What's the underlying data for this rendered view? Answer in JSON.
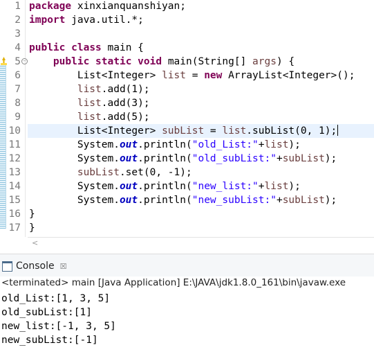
{
  "editor": {
    "lines": [
      {
        "n": "1",
        "tokens": [
          {
            "t": "package",
            "c": "kw"
          },
          {
            "t": " xinxianquanshiyan;",
            "c": ""
          }
        ]
      },
      {
        "n": "2",
        "tokens": [
          {
            "t": "import",
            "c": "kw"
          },
          {
            "t": " java.util.*;",
            "c": ""
          }
        ]
      },
      {
        "n": "3",
        "tokens": []
      },
      {
        "n": "4",
        "tokens": [
          {
            "t": "public",
            "c": "kw"
          },
          {
            "t": " ",
            "c": ""
          },
          {
            "t": "class",
            "c": "kw"
          },
          {
            "t": " main {",
            "c": ""
          }
        ]
      },
      {
        "n": "5",
        "tokens": [
          {
            "t": "    ",
            "c": ""
          },
          {
            "t": "public",
            "c": "kw"
          },
          {
            "t": " ",
            "c": ""
          },
          {
            "t": "static",
            "c": "kw"
          },
          {
            "t": " ",
            "c": ""
          },
          {
            "t": "void",
            "c": "kw"
          },
          {
            "t": " main(String[] ",
            "c": ""
          },
          {
            "t": "args",
            "c": "var"
          },
          {
            "t": ") {",
            "c": ""
          }
        ]
      },
      {
        "n": "6",
        "tokens": [
          {
            "t": "        List<Integer> ",
            "c": ""
          },
          {
            "t": "list",
            "c": "var"
          },
          {
            "t": " = ",
            "c": ""
          },
          {
            "t": "new",
            "c": "kw"
          },
          {
            "t": " ArrayList<Integer>();",
            "c": ""
          }
        ]
      },
      {
        "n": "7",
        "tokens": [
          {
            "t": "        ",
            "c": ""
          },
          {
            "t": "list",
            "c": "var"
          },
          {
            "t": ".add(1);",
            "c": ""
          }
        ]
      },
      {
        "n": "8",
        "tokens": [
          {
            "t": "        ",
            "c": ""
          },
          {
            "t": "list",
            "c": "var"
          },
          {
            "t": ".add(3);",
            "c": ""
          }
        ]
      },
      {
        "n": "9",
        "tokens": [
          {
            "t": "        ",
            "c": ""
          },
          {
            "t": "list",
            "c": "var"
          },
          {
            "t": ".add(5);",
            "c": ""
          }
        ]
      },
      {
        "n": "10",
        "tokens": [
          {
            "t": "        List<Integer> ",
            "c": ""
          },
          {
            "t": "subList",
            "c": "var"
          },
          {
            "t": " = ",
            "c": ""
          },
          {
            "t": "list",
            "c": "var"
          },
          {
            "t": ".subList(0, 1);",
            "c": ""
          }
        ]
      },
      {
        "n": "11",
        "tokens": [
          {
            "t": "        System.",
            "c": ""
          },
          {
            "t": "out",
            "c": "fld"
          },
          {
            "t": ".println(",
            "c": ""
          },
          {
            "t": "\"old_List:\"",
            "c": "str"
          },
          {
            "t": "+",
            "c": ""
          },
          {
            "t": "list",
            "c": "var"
          },
          {
            "t": ");",
            "c": ""
          }
        ]
      },
      {
        "n": "12",
        "tokens": [
          {
            "t": "        System.",
            "c": ""
          },
          {
            "t": "out",
            "c": "fld"
          },
          {
            "t": ".println(",
            "c": ""
          },
          {
            "t": "\"old_subList:\"",
            "c": "str"
          },
          {
            "t": "+",
            "c": ""
          },
          {
            "t": "subList",
            "c": "var"
          },
          {
            "t": ");",
            "c": ""
          }
        ]
      },
      {
        "n": "13",
        "tokens": [
          {
            "t": "        ",
            "c": ""
          },
          {
            "t": "subList",
            "c": "var"
          },
          {
            "t": ".set(0, -1);",
            "c": ""
          }
        ]
      },
      {
        "n": "14",
        "tokens": [
          {
            "t": "        System.",
            "c": ""
          },
          {
            "t": "out",
            "c": "fld"
          },
          {
            "t": ".println(",
            "c": ""
          },
          {
            "t": "\"new_list:\"",
            "c": "str"
          },
          {
            "t": "+",
            "c": ""
          },
          {
            "t": "list",
            "c": "var"
          },
          {
            "t": ");",
            "c": ""
          }
        ]
      },
      {
        "n": "15",
        "tokens": [
          {
            "t": "        System.",
            "c": ""
          },
          {
            "t": "out",
            "c": "fld"
          },
          {
            "t": ".println(",
            "c": ""
          },
          {
            "t": "\"new_subList:\"",
            "c": "str"
          },
          {
            "t": "+",
            "c": ""
          },
          {
            "t": "subList",
            "c": "var"
          },
          {
            "t": ");",
            "c": ""
          }
        ]
      },
      {
        "n": "16",
        "tokens": [
          {
            "t": "}",
            "c": ""
          }
        ]
      },
      {
        "n": "17",
        "tokens": [
          {
            "t": "}",
            "c": ""
          }
        ]
      }
    ],
    "current_line": "10",
    "fold_marker_line": "5",
    "warning_line": "5",
    "scroll_left_icon": "chevron-left-icon"
  },
  "console": {
    "tab_label": "Console",
    "tab_icon": "console-icon",
    "close_icon": "close-icon",
    "status": "<terminated> main [Java Application] E:\\JAVA\\jdk1.8.0_161\\bin\\javaw.exe",
    "output": [
      "old_List:[1, 3, 5]",
      "old_subList:[1]",
      "new_list:[-1, 3, 5]",
      "new_subList:[-1]"
    ]
  },
  "colors": {
    "keyword": "#7f0055",
    "string": "#2a00ff",
    "field": "#0000c0",
    "local_var": "#6a3e3e",
    "current_line_bg": "#e8f2fe"
  }
}
